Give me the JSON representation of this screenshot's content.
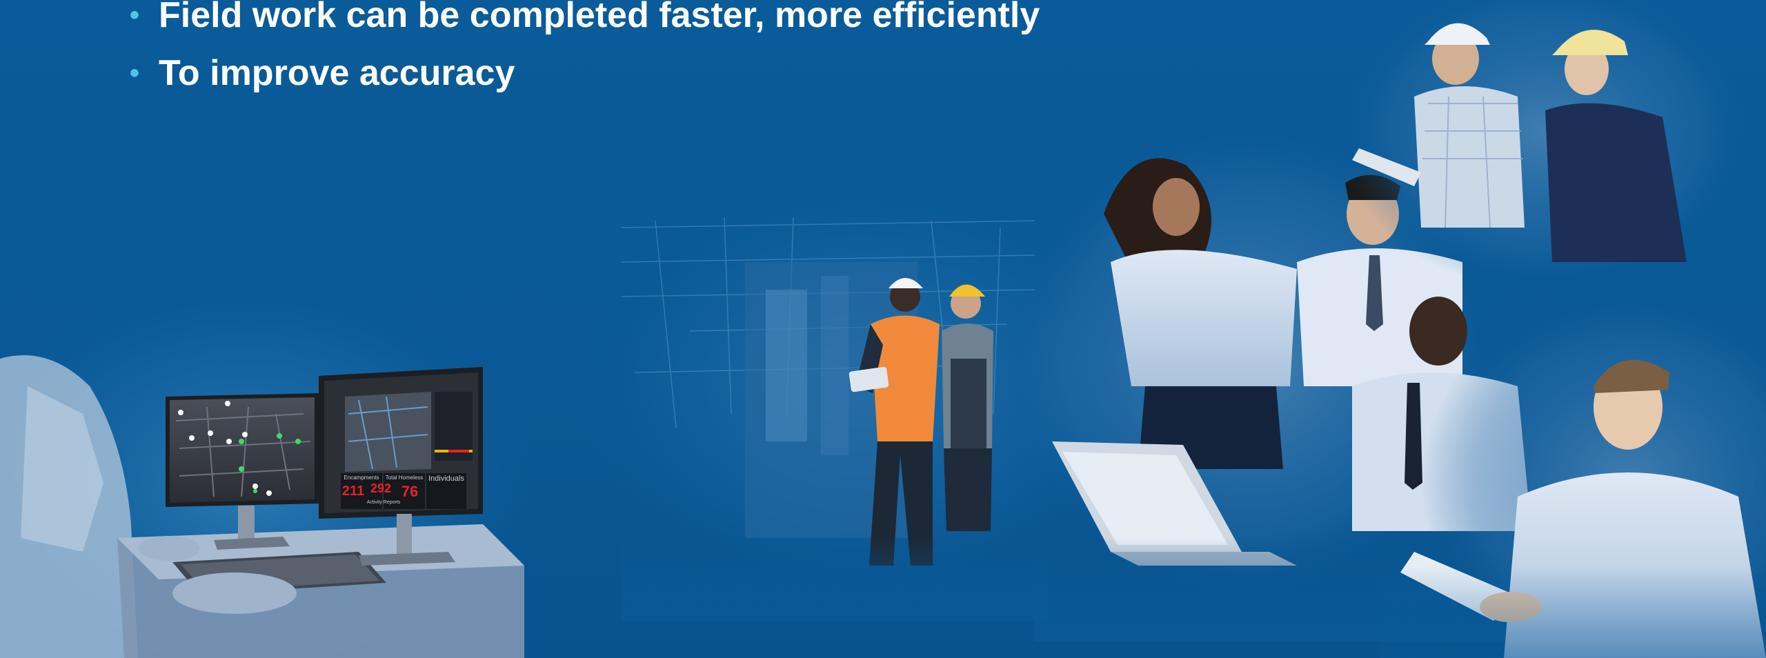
{
  "slide": {
    "bullets": [
      "Field work can be completed faster, more efficiently",
      "To improve accuracy"
    ],
    "bullet_symbol": "•",
    "colors": {
      "background": "#0a5a98",
      "bullet_text": "#ffffff",
      "bullet_marker": "#54c3e8"
    }
  },
  "dashboard": {
    "metrics": [
      {
        "label": "Encampments",
        "value": "211"
      },
      {
        "label": "Total Homeless",
        "value": "292"
      },
      {
        "label": "Individuals",
        "value": "76"
      }
    ],
    "footer": "Activity Reports",
    "value_color": "#e8212b"
  },
  "images": {
    "office_worker": "person-at-dual-monitors",
    "field_workers": "field-workers-with-tablet",
    "team_meeting": "team-around-laptop",
    "engineers": "engineers-with-hard-hats",
    "reader": "man-reading-tablet"
  }
}
